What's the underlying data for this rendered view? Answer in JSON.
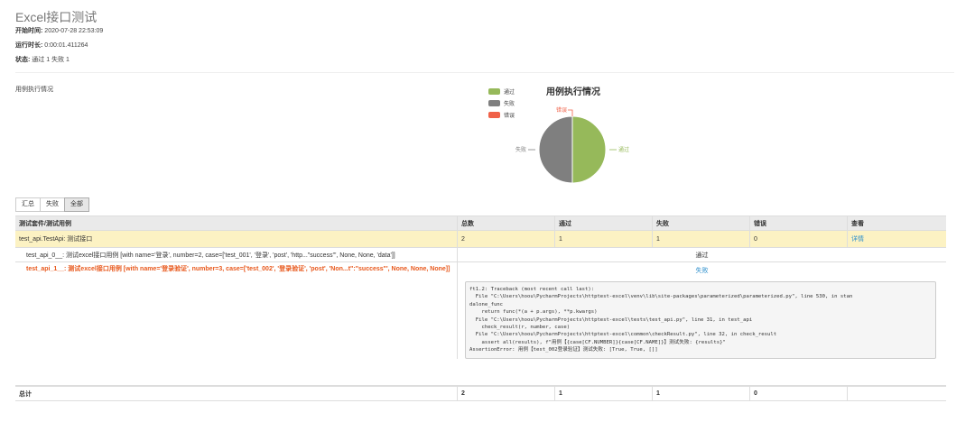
{
  "report": {
    "title": "Excel接口测试",
    "start_label": "开始时间:",
    "start_value": "2020-07-28 22:53:09",
    "duration_label": "运行时长:",
    "duration_value": "0:00:01.411264",
    "status_label": "状态:",
    "status_value": "通过 1 失败 1"
  },
  "section_label": "用例执行情况",
  "chart_data": {
    "type": "pie",
    "title": "用例执行情况",
    "legend_position": "top-left",
    "slices": [
      {
        "name": "通过",
        "value": 1,
        "color": "#96b95a"
      },
      {
        "name": "失败",
        "value": 1,
        "color": "#7f7f7f"
      },
      {
        "name": "错误",
        "value": 0,
        "color": "#f06148"
      }
    ]
  },
  "filters": [
    "汇总",
    "失败",
    "全部"
  ],
  "active_filter": "全部",
  "table": {
    "headers": [
      "测试套件/测试用例",
      "总数",
      "通过",
      "失败",
      "错误",
      "查看"
    ],
    "suite": {
      "name": "test_api.TestApi: 测试接口",
      "total": "2",
      "pass": "1",
      "fail": "1",
      "error": "0",
      "detail": "详情"
    },
    "pass_case": {
      "name": "test_api_0__: 测试excel接口用例 [with name='登录', number=2, case=['test_001', '登录', 'post', 'http...\"success\"', None, None, 'data']]",
      "result": "通过"
    },
    "fail_case": {
      "name": "test_api_1__: 测试excel接口用例 [with name='登录验证', number=3, case=['test_002', '登录验证', 'post', 'Non...t\":\"success\"', None, None, None]]",
      "result": "失败",
      "traceback": "ft1.2: Traceback (most recent call last):\n  File \"C:\\Users\\hoou\\PycharmProjects\\httptest-excel\\venv\\lib\\site-packages\\parameterized\\parameterized.py\", line 530, in stan\ndalone_func\n    return func(*(a + p.args), **p.kwargs)\n  File \"C:\\Users\\hoou\\PycharmProjects\\httptest-excel\\tests\\test_api.py\", line 31, in test_api\n    check_result(r, number, case)\n  File \"C:\\Users\\hoou\\PycharmProjects\\httptest-excel\\common\\checkResult.py\", line 32, in check_result\n    assert all(results), f\"用例【{case[CF.NUMBER]}{case[CF.NAME]}】测试失败: {results}\"\nAssertionError: 用例【test_002登录验证】测试失败: [True, True, []]"
    },
    "total": {
      "label": "总计",
      "total": "2",
      "pass": "1",
      "fail": "1",
      "error": "0"
    }
  }
}
